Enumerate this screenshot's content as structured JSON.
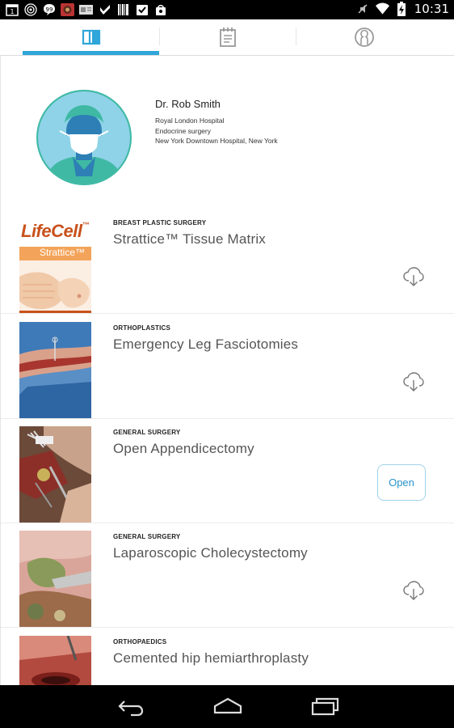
{
  "status_bar": {
    "time": "10:31",
    "left_icons": [
      "calendar-icon",
      "radar-icon",
      "message-icon",
      "photo-thumbnail",
      "news-icon",
      "check-icon",
      "barcode-icon",
      "task-check-icon",
      "bag-icon"
    ],
    "right_icons": [
      "mute-icon",
      "wifi-icon",
      "battery-charging-icon"
    ]
  },
  "tabs": {
    "items": [
      {
        "name": "library",
        "icon": "book-icon",
        "active": true
      },
      {
        "name": "notes",
        "icon": "notepad-icon",
        "active": false
      },
      {
        "name": "profile",
        "icon": "user-icon",
        "active": false
      }
    ],
    "accent_color": "#2fa6d9"
  },
  "profile": {
    "name": "Dr. Rob Smith",
    "lines": [
      "Royal London Hospital",
      "Endocrine surgery",
      "New York Downtown Hospital, New York"
    ]
  },
  "procedures": [
    {
      "category": "BREAST PLASTIC SURGERY",
      "title": "Strattice™ Tissue Matrix",
      "action": "download",
      "thumb": {
        "brand": "LifeCell",
        "tm": "™",
        "band": "Strattice™"
      }
    },
    {
      "category": "ORTHOPLASTICS",
      "title": "Emergency Leg Fasciotomies",
      "action": "download"
    },
    {
      "category": "GENERAL SURGERY",
      "title": "Open Appendicectomy",
      "action": "open",
      "action_label": "Open"
    },
    {
      "category": "GENERAL SURGERY",
      "title": "Laparoscopic Cholecystectomy",
      "action": "download"
    },
    {
      "category": "ORTHOPAEDICS",
      "title": "Cemented hip hemiarthroplasty",
      "action": "download"
    }
  ],
  "nav_bar": {
    "buttons": [
      "back-icon",
      "home-icon",
      "recents-icon"
    ]
  }
}
